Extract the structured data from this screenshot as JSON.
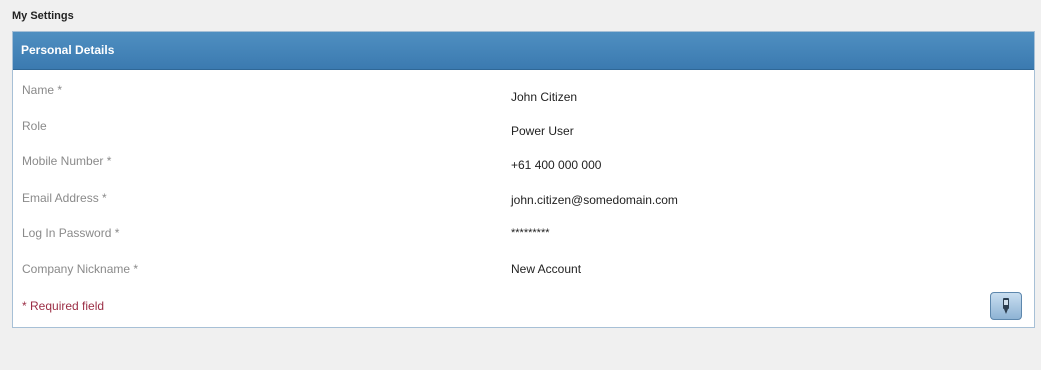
{
  "page": {
    "title": "My Settings"
  },
  "panel": {
    "header": "Personal Details",
    "rows": [
      {
        "label": "Name *",
        "value": "John Citizen"
      },
      {
        "label": "Role",
        "value": "Power User"
      },
      {
        "label": "Mobile Number *",
        "value": "+61 400 000 000"
      },
      {
        "label": "Email Address *",
        "value": "john.citizen@somedomain.com"
      },
      {
        "label": "Log In Password *",
        "value": "*********"
      },
      {
        "label": "Company Nickname *",
        "value": "New Account"
      }
    ],
    "required_note": "* Required field",
    "edit_button_icon": "edit-icon"
  },
  "colors": {
    "header_blue": "#3b7ab0",
    "label_gray": "#8a8a8a",
    "required_red": "#9b2e45"
  }
}
